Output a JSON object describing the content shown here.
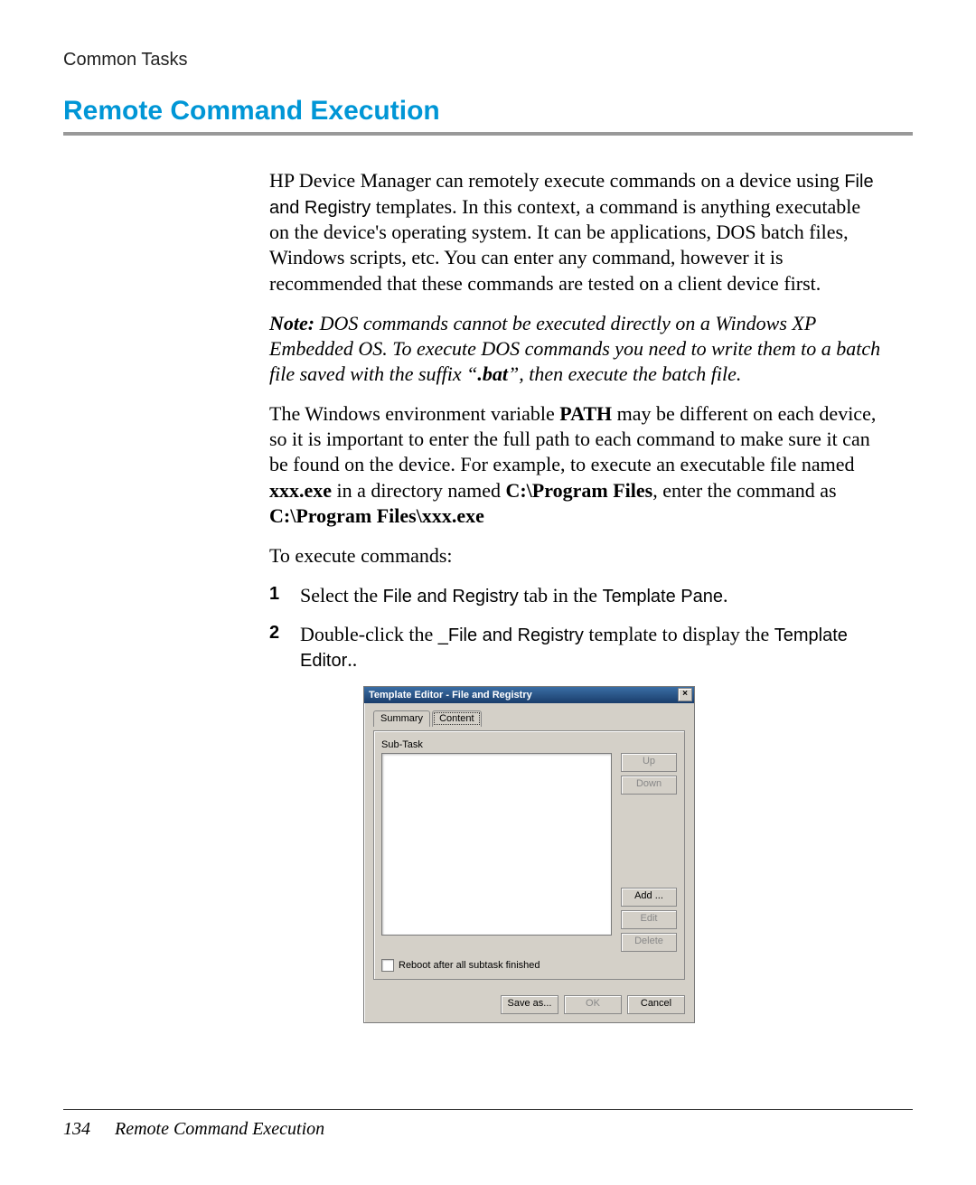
{
  "header": {
    "breadcrumb": "Common Tasks"
  },
  "title": "Remote Command Execution",
  "para1": {
    "lead": "HP Device Manager can remotely execute commands on a device using ",
    "template_name": "File and Registry",
    "rest": " templates. In this context, a command is anything executable on the device's operating system. It can be applications, DOS batch files, Windows scripts, etc. You can enter any command, however it is recommended that these commands are tested on a client device first."
  },
  "note": {
    "label": "Note:",
    "body_a": " DOS commands cannot be executed directly on a Windows XP Embedded OS. To execute DOS commands you need to write them to a batch file saved with the suffix “",
    "bat": ".bat",
    "body_b": "”, then execute the batch file."
  },
  "para2": {
    "a": "The Windows environment variable ",
    "path": "PATH",
    "b": " may be different on each device, so it is important to enter the full path to each command to make sure it can be found on the device. For example, to execute an executable file named ",
    "exe": "xxx.exe",
    "c": " in a directory named ",
    "dir": "C:\\Program Files",
    "d": ", enter the command as ",
    "full": "C:\\Program Files\\xxx.exe"
  },
  "para3": "To execute commands:",
  "steps": {
    "s1": {
      "a": "Select the ",
      "tab": "File and Registry",
      "b": " tab in the ",
      "pane": "Template Pane",
      "c": "."
    },
    "s2": {
      "a": "Double-click the ",
      "tpl": "_File and Registry",
      "b": " template to display the ",
      "editor": "Template Editor",
      "c": ".."
    }
  },
  "dialog": {
    "title": "Template Editor - File and Registry",
    "close": "×",
    "tabs": {
      "summary": "Summary",
      "content": "Content"
    },
    "subtask_label": "Sub-Task",
    "buttons": {
      "up": "Up",
      "down": "Down",
      "add": "Add ...",
      "edit": "Edit",
      "delete": "Delete",
      "save_as": "Save as...",
      "ok": "OK",
      "cancel": "Cancel"
    },
    "reboot_label": "Reboot after all subtask finished"
  },
  "footer": {
    "page_num": "134",
    "title": "Remote Command Execution"
  }
}
